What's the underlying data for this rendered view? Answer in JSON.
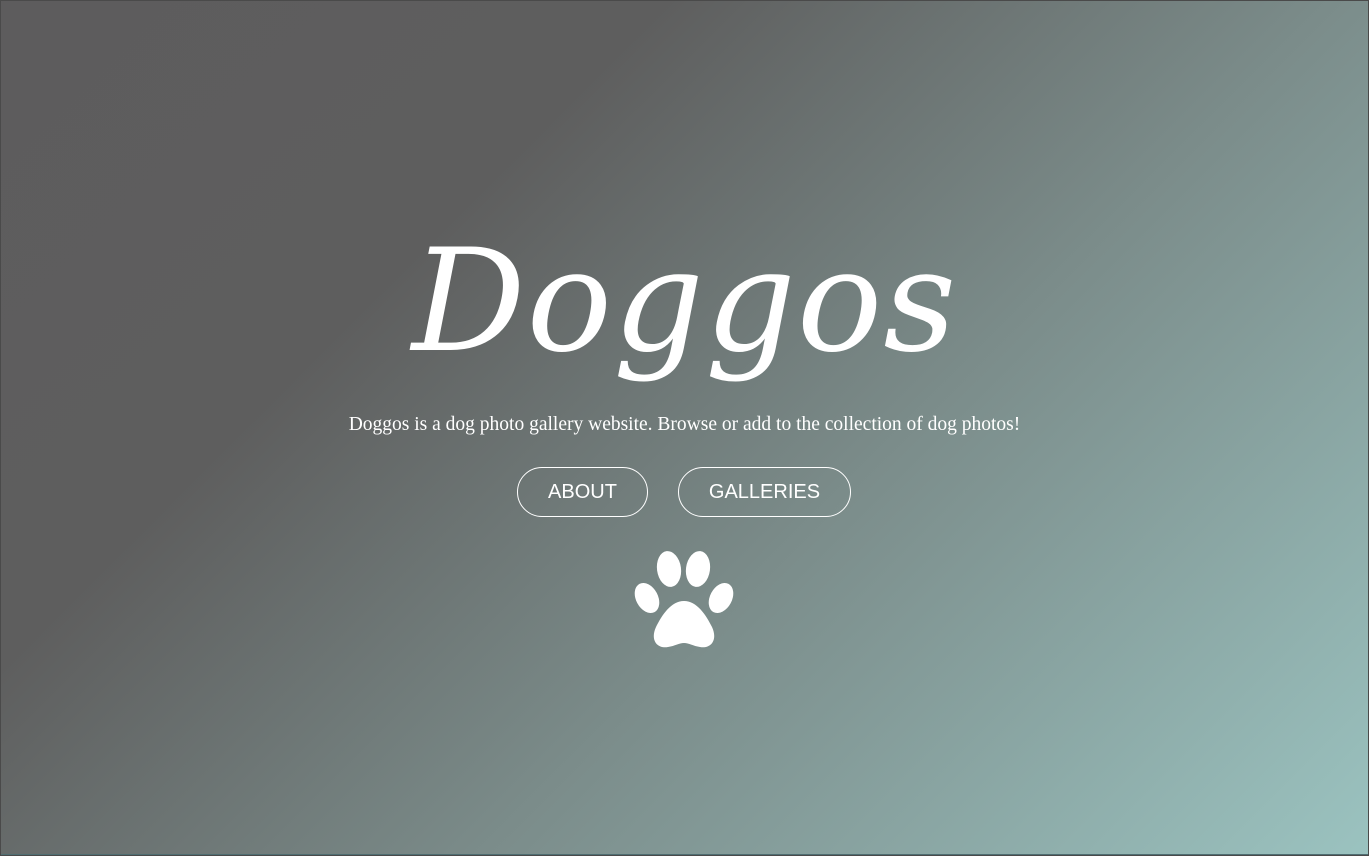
{
  "site": {
    "title": "Doggos",
    "tagline": "Doggos is a dog photo gallery website. Browse or add to the collection of dog photos!"
  },
  "nav": {
    "about_label": "ABOUT",
    "galleries_label": "GALLERIES"
  },
  "icons": {
    "paw": "paw-print-icon"
  },
  "colors": {
    "text": "#ffffff",
    "gradient_start": "#5d5c5d",
    "gradient_end": "#9bc3c0"
  }
}
